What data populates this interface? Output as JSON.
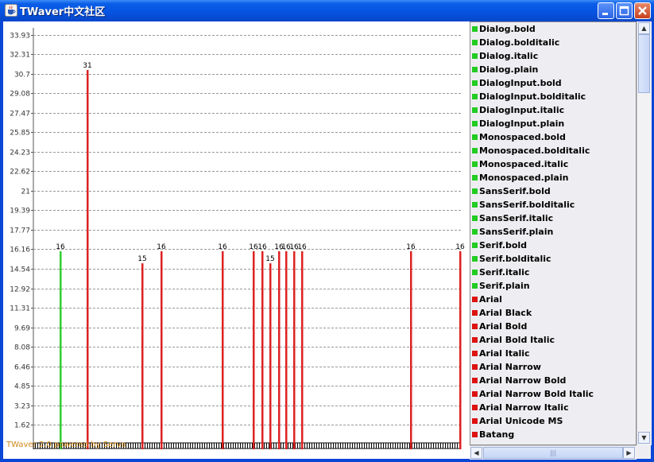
{
  "window": {
    "title": "TWaver中文社区",
    "app_icon": "java-cup-icon",
    "buttons": [
      "minimize-icon",
      "maximize-icon",
      "close-icon"
    ]
  },
  "watermark": "TWaver 2.0 powered by Serva",
  "chart_data": {
    "type": "bar",
    "title": "",
    "xlabel": "",
    "ylabel": "",
    "ylim": [
      0,
      33.93
    ],
    "yticks": [
      "1.62",
      "3.23",
      "4.85",
      "6.46",
      "8.08",
      "9.69",
      "11.31",
      "12.92",
      "14.54",
      "16.16",
      "17.77",
      "19.39",
      "21",
      "22.62",
      "24.23",
      "25.85",
      "27.47",
      "29.08",
      "30.7",
      "32.31",
      "33.93"
    ],
    "grid": true,
    "bar_positions": [
      0.066,
      0.13,
      0.258,
      0.302,
      0.444,
      0.517,
      0.537,
      0.557,
      0.577,
      0.594,
      0.612,
      0.63,
      0.885,
      1.0
    ],
    "values": [
      16,
      31,
      15,
      16,
      16,
      16,
      16,
      15,
      16,
      16,
      16,
      16,
      16,
      16
    ],
    "colors": [
      "#33cc33",
      "#dd2222",
      "#dd2222",
      "#dd2222",
      "#dd2222",
      "#dd2222",
      "#dd2222",
      "#dd2222",
      "#dd2222",
      "#dd2222",
      "#dd2222",
      "#dd2222",
      "#dd2222",
      "#dd2222"
    ],
    "legend_placement": "right"
  },
  "legend": {
    "items": [
      {
        "label": "Dialog.bold",
        "color": "#22cc22"
      },
      {
        "label": "Dialog.bolditalic",
        "color": "#22cc22"
      },
      {
        "label": "Dialog.italic",
        "color": "#22cc22"
      },
      {
        "label": "Dialog.plain",
        "color": "#22cc22"
      },
      {
        "label": "DialogInput.bold",
        "color": "#22cc22"
      },
      {
        "label": "DialogInput.bolditalic",
        "color": "#22cc22"
      },
      {
        "label": "DialogInput.italic",
        "color": "#22cc22"
      },
      {
        "label": "DialogInput.plain",
        "color": "#22cc22"
      },
      {
        "label": "Monospaced.bold",
        "color": "#22cc22"
      },
      {
        "label": "Monospaced.bolditalic",
        "color": "#22cc22"
      },
      {
        "label": "Monospaced.italic",
        "color": "#22cc22"
      },
      {
        "label": "Monospaced.plain",
        "color": "#22cc22"
      },
      {
        "label": "SansSerif.bold",
        "color": "#22cc22"
      },
      {
        "label": "SansSerif.bolditalic",
        "color": "#22cc22"
      },
      {
        "label": "SansSerif.italic",
        "color": "#22cc22"
      },
      {
        "label": "SansSerif.plain",
        "color": "#22cc22"
      },
      {
        "label": "Serif.bold",
        "color": "#22cc22"
      },
      {
        "label": "Serif.bolditalic",
        "color": "#22cc22"
      },
      {
        "label": "Serif.italic",
        "color": "#22cc22"
      },
      {
        "label": "Serif.plain",
        "color": "#22cc22"
      },
      {
        "label": "Arial",
        "color": "#dd1111"
      },
      {
        "label": "Arial Black",
        "color": "#dd1111"
      },
      {
        "label": "Arial Bold",
        "color": "#dd1111"
      },
      {
        "label": "Arial Bold Italic",
        "color": "#dd1111"
      },
      {
        "label": "Arial Italic",
        "color": "#dd1111"
      },
      {
        "label": "Arial Narrow",
        "color": "#dd1111"
      },
      {
        "label": "Arial Narrow Bold",
        "color": "#dd1111"
      },
      {
        "label": "Arial Narrow Bold Italic",
        "color": "#dd1111"
      },
      {
        "label": "Arial Narrow Italic",
        "color": "#dd1111"
      },
      {
        "label": "Arial Unicode MS",
        "color": "#dd1111"
      },
      {
        "label": "Batang",
        "color": "#dd1111"
      }
    ]
  }
}
